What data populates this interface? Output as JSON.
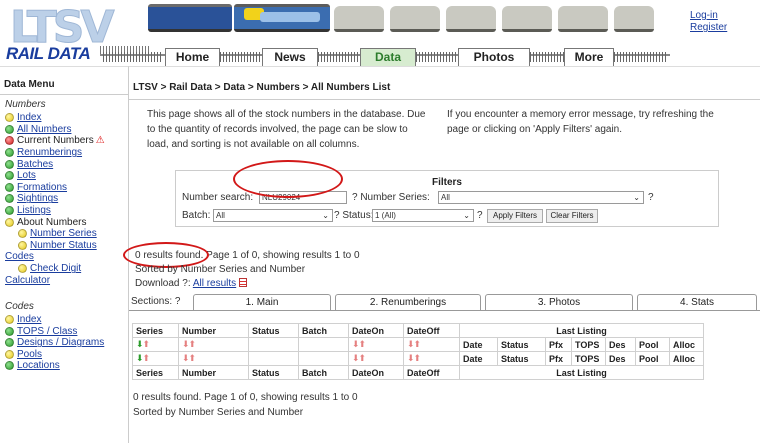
{
  "header": {
    "logo_text": "LTSV",
    "logo_subtitle": "RAIL DATA",
    "nav": [
      "Home",
      "News",
      "Data",
      "Photos",
      "More"
    ],
    "active_nav": "Data",
    "login": "Log-in",
    "register": "Register"
  },
  "sidebar": {
    "title": "Data Menu",
    "numbers_heading": "Numbers",
    "numbers_items": [
      {
        "label": "Index",
        "dot": "yellow",
        "link": true
      },
      {
        "label": "All Numbers",
        "dot": "green",
        "link": true
      },
      {
        "label": "Current Numbers",
        "dot": "red",
        "link": false,
        "warn": "⚠"
      },
      {
        "label": "Renumberings",
        "dot": "green",
        "link": true
      },
      {
        "label": "Batches",
        "dot": "green",
        "link": true
      },
      {
        "label": "Lots",
        "dot": "green",
        "link": true
      },
      {
        "label": "Formations",
        "dot": "green",
        "link": true
      },
      {
        "label": "Sightings",
        "dot": "green",
        "link": true
      },
      {
        "label": "Listings",
        "dot": "green",
        "link": true
      },
      {
        "label": "About Numbers",
        "dot": "yellow",
        "link": false
      },
      {
        "label": "Number Series",
        "dot": "yellow",
        "link": true,
        "sub": true
      },
      {
        "label": "Number Status",
        "dot": "yellow",
        "link": true,
        "sub": true
      }
    ],
    "codes_link": "Codes",
    "check_digit": "Check Digit",
    "calculator": "Calculator",
    "codes_heading": "Codes",
    "codes_items": [
      {
        "label": "Index",
        "dot": "yellow"
      },
      {
        "label": "TOPS / Class",
        "dot": "green"
      },
      {
        "label": "Designs / Diagrams",
        "dot": "green"
      },
      {
        "label": "Pools",
        "dot": "yellow"
      },
      {
        "label": "Locations",
        "dot": "green"
      }
    ]
  },
  "main": {
    "breadcrumb": "LTSV > Rail Data > Data > Numbers > All Numbers List",
    "intro_left": [
      "This page shows all of the stock numbers in the database. Due",
      "to the quantity of records involved, the page can be slow to",
      "load, and sorting is not available on all columns."
    ],
    "intro_right": [
      "If you encounter a memory error message, try refreshing the",
      "page or clicking on 'Apply Filters' again."
    ],
    "filters": {
      "title": "Filters",
      "number_search_label": "Number search:",
      "number_search_value": "NLU29024",
      "number_series_label": "? Number Series:",
      "number_series_value": "All",
      "q1": "?",
      "batch_label": "Batch:",
      "batch_value": "All",
      "status_label": "? Status:",
      "status_value": "1 (All)",
      "q2": "?",
      "apply": "Apply Filters",
      "clear": "Clear Filters"
    },
    "results_text": "0 results found. Page 1 of 0, showing results 1 to 0",
    "sorted_text": "Sorted by Number Series and Number",
    "download_label": "Download ?:",
    "download_link": "All results",
    "sections_label": "Sections: ?",
    "tabs": [
      "1. Main",
      "2. Renumberings",
      "3. Photos",
      "4. Stats"
    ],
    "table": {
      "left_headers": [
        "Series",
        "Number",
        "Status",
        "Batch",
        "DateOn",
        "DateOff"
      ],
      "last_listing": "Last Listing",
      "right_headers": [
        "Date",
        "Status",
        "Pfx",
        "TOPS",
        "Des",
        "Pool",
        "Alloc"
      ]
    },
    "results_text_bottom": "0 results found. Page 1 of 0, showing results 1 to 0",
    "sorted_text_bottom": "Sorted by Number Series and Number"
  }
}
